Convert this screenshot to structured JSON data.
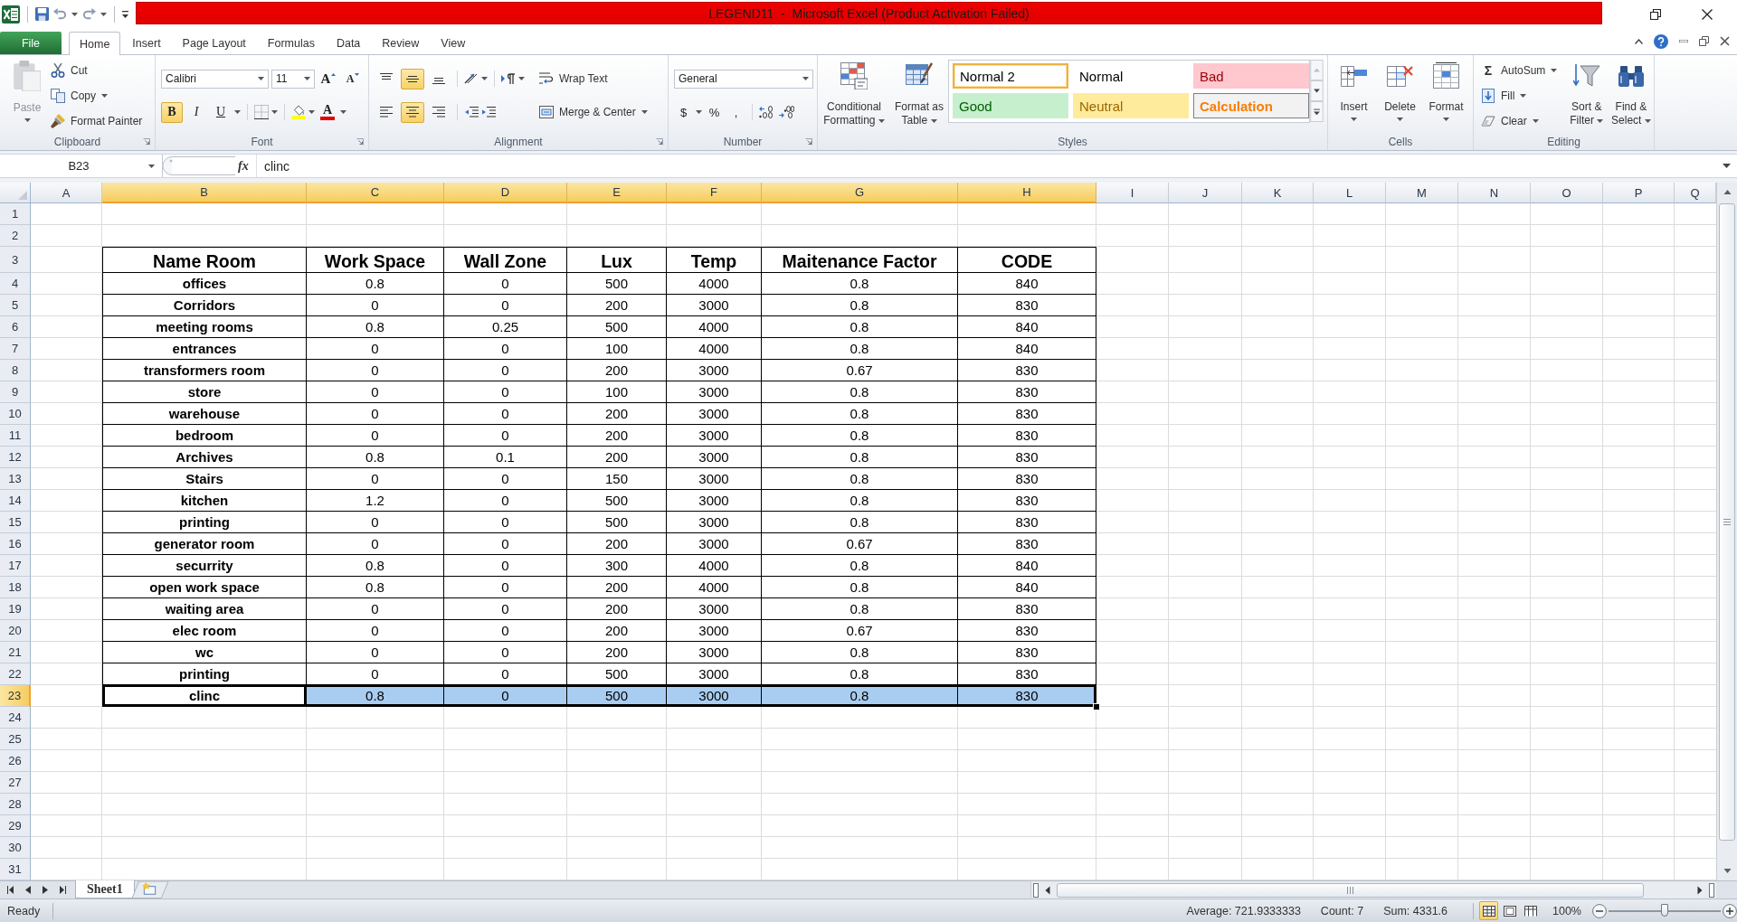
{
  "window": {
    "title": "LEGEND11  -  Microsoft Excel (Product Activation Failed)"
  },
  "ribbon_tabs": [
    {
      "label": "File",
      "kind": "file",
      "selected": false
    },
    {
      "label": "Home",
      "kind": "tab",
      "selected": true
    },
    {
      "label": "Insert",
      "kind": "tab",
      "selected": false
    },
    {
      "label": "Page Layout",
      "kind": "tab",
      "selected": false
    },
    {
      "label": "Formulas",
      "kind": "tab",
      "selected": false
    },
    {
      "label": "Data",
      "kind": "tab",
      "selected": false
    },
    {
      "label": "Review",
      "kind": "tab",
      "selected": false
    },
    {
      "label": "View",
      "kind": "tab",
      "selected": false
    }
  ],
  "clipboard": {
    "label": "Clipboard",
    "paste": {
      "label": "Paste",
      "disabled": true
    },
    "cut": "Cut",
    "copy": "Copy",
    "format_painter": "Format Painter"
  },
  "font": {
    "label": "Font",
    "font_name": "Calibri",
    "font_size": "11",
    "grow_font": "A",
    "shrink_font": "A",
    "format_buttons": [
      {
        "label": "B",
        "kind": "bold",
        "selected": true
      },
      {
        "label": "I",
        "kind": "italic",
        "selected": false
      },
      {
        "label": "U",
        "kind": "underline",
        "selected": false
      }
    ],
    "font_color": "A"
  },
  "alignment": {
    "label": "Alignment",
    "vertical": [
      {
        "kind": "top",
        "selected": false
      },
      {
        "kind": "middle",
        "selected": true
      },
      {
        "kind": "bottom",
        "selected": false
      }
    ],
    "horizontal": [
      {
        "kind": "left",
        "selected": false
      },
      {
        "kind": "center",
        "selected": true
      },
      {
        "kind": "right",
        "selected": false
      }
    ],
    "wrap_text": "Wrap Text",
    "merge_center": "Merge & Center"
  },
  "number": {
    "label": "Number",
    "format": "General",
    "currency": "$",
    "percent": "%",
    "comma": ","
  },
  "styles": {
    "label": "Styles",
    "conditional_formatting": "Conditional Formatting",
    "format_as_table": "Format as Table",
    "gallery": [
      {
        "label": "Normal 2",
        "kind": "normal",
        "selected": true
      },
      {
        "label": "Normal",
        "kind": "normal",
        "selected": false
      },
      {
        "label": "Bad",
        "kind": "bad",
        "selected": false
      },
      {
        "label": "Good",
        "kind": "good",
        "selected": false
      },
      {
        "label": "Neutral",
        "kind": "neutral",
        "selected": false
      },
      {
        "label": "Calculation",
        "kind": "calculation",
        "selected": false
      }
    ]
  },
  "cells": {
    "label": "Cells",
    "buttons": [
      {
        "label": "Insert",
        "kind": "insert"
      },
      {
        "label": "Delete",
        "kind": "delete"
      },
      {
        "label": "Format",
        "kind": "format"
      }
    ]
  },
  "editing": {
    "label": "Editing",
    "autosum_symbol": "Σ",
    "autosum": "AutoSum",
    "fill": "Fill",
    "clear": "Clear",
    "sort_filter": "Sort & Filter",
    "find_select": "Find & Select"
  },
  "formula_bar": {
    "name_box": "B23",
    "function_symbol": "fx",
    "formula": "clinc"
  },
  "sheet": {
    "columns": [
      {
        "label": "A",
        "selected": false
      },
      {
        "label": "B",
        "selected": true
      },
      {
        "label": "C",
        "selected": true
      },
      {
        "label": "D",
        "selected": true
      },
      {
        "label": "E",
        "selected": true
      },
      {
        "label": "F",
        "selected": true
      },
      {
        "label": "G",
        "selected": true
      },
      {
        "label": "H",
        "selected": true
      },
      {
        "label": "I",
        "selected": false
      },
      {
        "label": "J",
        "selected": false
      },
      {
        "label": "K",
        "selected": false
      },
      {
        "label": "L",
        "selected": false
      },
      {
        "label": "M",
        "selected": false
      },
      {
        "label": "N",
        "selected": false
      },
      {
        "label": "O",
        "selected": false
      },
      {
        "label": "P",
        "selected": false
      },
      {
        "label": "Q",
        "selected": false
      }
    ],
    "rows": [
      {
        "label": "1",
        "selected": false
      },
      {
        "label": "2",
        "selected": false
      },
      {
        "label": "3",
        "selected": false
      },
      {
        "label": "4",
        "selected": false
      },
      {
        "label": "5",
        "selected": false
      },
      {
        "label": "6",
        "selected": false
      },
      {
        "label": "7",
        "selected": false
      },
      {
        "label": "8",
        "selected": false
      },
      {
        "label": "9",
        "selected": false
      },
      {
        "label": "10",
        "selected": false
      },
      {
        "label": "11",
        "selected": false
      },
      {
        "label": "12",
        "selected": false
      },
      {
        "label": "13",
        "selected": false
      },
      {
        "label": "14",
        "selected": false
      },
      {
        "label": "15",
        "selected": false
      },
      {
        "label": "16",
        "selected": false
      },
      {
        "label": "17",
        "selected": false
      },
      {
        "label": "18",
        "selected": false
      },
      {
        "label": "19",
        "selected": false
      },
      {
        "label": "20",
        "selected": false
      },
      {
        "label": "21",
        "selected": false
      },
      {
        "label": "22",
        "selected": false
      },
      {
        "label": "23",
        "selected": true
      },
      {
        "label": "24",
        "selected": false
      },
      {
        "label": "25",
        "selected": false
      },
      {
        "label": "26",
        "selected": false
      },
      {
        "label": "27",
        "selected": false
      },
      {
        "label": "28",
        "selected": false
      },
      {
        "label": "29",
        "selected": false
      },
      {
        "label": "30",
        "selected": false
      },
      {
        "label": "31",
        "selected": false
      }
    ]
  },
  "table": {
    "header": [
      "Name Room",
      "Work Space",
      "Wall Zone",
      "Lux",
      "Temp",
      "Maitenance Factor",
      "CODE"
    ],
    "rows": [
      {
        "cells": [
          "offices",
          "0.8",
          "0",
          "500",
          "4000",
          "0.8",
          "840"
        ],
        "selected": false
      },
      {
        "cells": [
          "Corridors",
          "0",
          "0",
          "200",
          "3000",
          "0.8",
          "830"
        ],
        "selected": false
      },
      {
        "cells": [
          "meeting rooms",
          "0.8",
          "0.25",
          "500",
          "4000",
          "0.8",
          "840"
        ],
        "selected": false
      },
      {
        "cells": [
          "entrances",
          "0",
          "0",
          "100",
          "4000",
          "0.8",
          "840"
        ],
        "selected": false
      },
      {
        "cells": [
          "transformers room",
          "0",
          "0",
          "200",
          "3000",
          "0.67",
          "830"
        ],
        "selected": false
      },
      {
        "cells": [
          "store",
          "0",
          "0",
          "100",
          "3000",
          "0.8",
          "830"
        ],
        "selected": false
      },
      {
        "cells": [
          "warehouse",
          "0",
          "0",
          "200",
          "3000",
          "0.8",
          "830"
        ],
        "selected": false
      },
      {
        "cells": [
          "bedroom",
          "0",
          "0",
          "200",
          "3000",
          "0.8",
          "830"
        ],
        "selected": false
      },
      {
        "cells": [
          "Archives",
          "0.8",
          "0.1",
          "200",
          "3000",
          "0.8",
          "830"
        ],
        "selected": false
      },
      {
        "cells": [
          "Stairs",
          "0",
          "0",
          "150",
          "3000",
          "0.8",
          "830"
        ],
        "selected": false
      },
      {
        "cells": [
          "kitchen",
          "1.2",
          "0",
          "500",
          "3000",
          "0.8",
          "830"
        ],
        "selected": false
      },
      {
        "cells": [
          "printing",
          "0",
          "0",
          "500",
          "3000",
          "0.8",
          "830"
        ],
        "selected": false
      },
      {
        "cells": [
          "generator room",
          "0",
          "0",
          "200",
          "3000",
          "0.67",
          "830"
        ],
        "selected": false
      },
      {
        "cells": [
          "securrity",
          "0.8",
          "0",
          "300",
          "4000",
          "0.8",
          "840"
        ],
        "selected": false
      },
      {
        "cells": [
          "open work space",
          "0.8",
          "0",
          "200",
          "4000",
          "0.8",
          "840"
        ],
        "selected": false
      },
      {
        "cells": [
          "waiting area",
          "0",
          "0",
          "200",
          "3000",
          "0.8",
          "830"
        ],
        "selected": false
      },
      {
        "cells": [
          "elec room",
          "0",
          "0",
          "200",
          "3000",
          "0.67",
          "830"
        ],
        "selected": false
      },
      {
        "cells": [
          "wc",
          "0",
          "0",
          "200",
          "3000",
          "0.8",
          "830"
        ],
        "selected": false
      },
      {
        "cells": [
          "printing",
          "0",
          "0",
          "500",
          "3000",
          "0.8",
          "830"
        ],
        "selected": false
      },
      {
        "cells": [
          "clinc",
          "0.8",
          "0",
          "500",
          "3000",
          "0.8",
          "830"
        ],
        "selected": true
      }
    ]
  },
  "sheet_tabs": [
    {
      "label": "Sheet1",
      "selected": true
    }
  ],
  "status_bar": {
    "mode": "Ready",
    "average": "Average: 721.9333333",
    "count": "Count: 7",
    "sum": "Sum: 4331.6",
    "views": [
      {
        "kind": "normal",
        "selected": true
      },
      {
        "kind": "page_layout",
        "selected": false
      },
      {
        "kind": "page_break",
        "selected": false
      }
    ],
    "zoom": "100%",
    "zoom_slider": {
      "level": 0.5
    }
  }
}
